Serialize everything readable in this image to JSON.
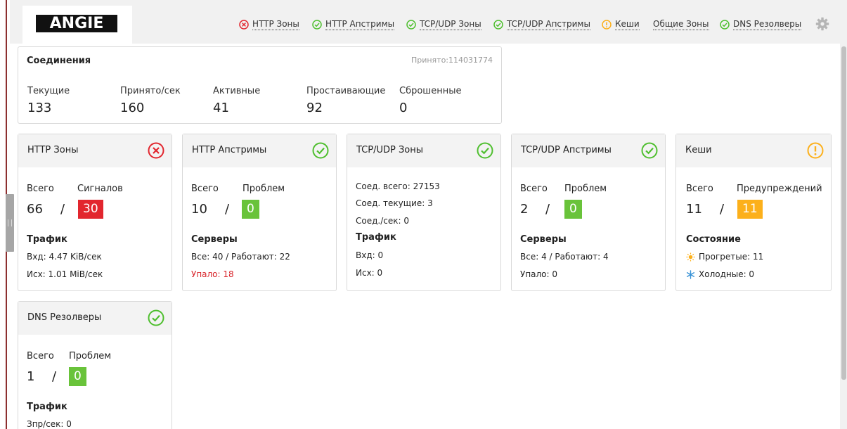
{
  "logo": "ANGIE",
  "nav": [
    {
      "label": "HTTP Зоны",
      "status": "error"
    },
    {
      "label": "HTTP Апстримы",
      "status": "ok"
    },
    {
      "label": "TCP/UDP Зоны",
      "status": "ok"
    },
    {
      "label": "TCP/UDP Апстримы",
      "status": "ok"
    },
    {
      "label": "Кеши",
      "status": "warning"
    },
    {
      "label": "Общие Зоны",
      "status": "none"
    },
    {
      "label": "DNS Резолверы",
      "status": "ok"
    }
  ],
  "settings_icon": "gear-icon",
  "connections": {
    "title": "Соединения",
    "accepted": "Принято:114031774",
    "stats": [
      {
        "label": "Текущие",
        "value": "133"
      },
      {
        "label": "Принято/сек",
        "value": "160"
      },
      {
        "label": "Активные",
        "value": "41"
      },
      {
        "label": "Простаивающие",
        "value": "92"
      },
      {
        "label": "Сброшенные",
        "value": "0"
      }
    ]
  },
  "cards": {
    "http_zones": {
      "title": "HTTP Зоны",
      "status": "error",
      "total_label": "Всего",
      "count_label": "Сигналов",
      "total": "66",
      "sep": "/",
      "count": "30",
      "section": "Трафик",
      "lines": [
        "Вхд: 4.47 KiB/сек",
        "Исх: 1.01 MiB/сек"
      ]
    },
    "http_upstreams": {
      "title": "HTTP Апстримы",
      "status": "ok",
      "total_label": "Всего",
      "count_label": "Проблем",
      "total": "10",
      "sep": "/",
      "count": "0",
      "section": "Серверы",
      "lines": [
        "Все: 40 / Работают: 22",
        "Упало: 18"
      ]
    },
    "tcp_zones": {
      "title": "TCP/UDP Зоны",
      "status": "ok",
      "lines": [
        "Соед. всего: 27153",
        "Соед. текущие: 3",
        "Соед./сек: 0"
      ],
      "section": "Трафик",
      "traffic": [
        "Вхд: 0",
        "Исх: 0"
      ]
    },
    "tcp_upstreams": {
      "title": "TCP/UDP Апстримы",
      "status": "ok",
      "total_label": "Всего",
      "count_label": "Проблем",
      "total": "2",
      "sep": "/",
      "count": "0",
      "section": "Серверы",
      "lines": [
        "Все: 4 / Работают: 4",
        "Упало: 0"
      ]
    },
    "caches": {
      "title": "Кеши",
      "status": "warning",
      "total_label": "Всего",
      "count_label": "Предупреждений",
      "total": "11",
      "sep": "/",
      "count": "11",
      "section": "Состояние",
      "lines": [
        "Прогретые: 11",
        "Холодные: 0"
      ],
      "icons": [
        "sun-icon",
        "snowflake-icon"
      ]
    },
    "dns": {
      "title": "DNS Резолверы",
      "status": "ok",
      "total_label": "Всего",
      "count_label": "Проблем",
      "total": "1",
      "sep": "/",
      "count": "0",
      "section": "Трафик",
      "lines": [
        "Зпр/сек: 0"
      ]
    }
  },
  "colors": {
    "ok": "#4fbf2f",
    "error": "#e2262e",
    "warning": "#fcb01b",
    "badge_red": "#e2262e",
    "badge_green": "#69c33a",
    "badge_orange": "#fcb01b"
  }
}
